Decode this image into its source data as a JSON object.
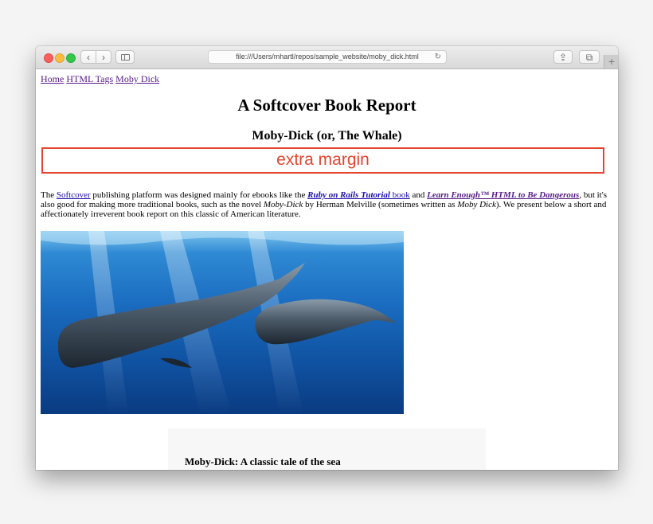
{
  "browser": {
    "url": "file:///Users/mhartl/repos/sample_website/moby_dick.html",
    "back_glyph": "‹",
    "forward_glyph": "›",
    "reload_glyph": "↻",
    "share_glyph": "⇪",
    "tabs_glyph": "⧉",
    "new_tab_glyph": "+"
  },
  "nav": {
    "links": [
      "Home",
      "HTML Tags",
      "Moby Dick"
    ]
  },
  "page": {
    "title": "A Softcover Book Report",
    "subtitle": "Moby-Dick (or, The Whale)",
    "annotation": "extra margin",
    "intro": {
      "t1": "The ",
      "link_softcover": "Softcover",
      "t2": " publishing platform was designed mainly for ebooks like the ",
      "link_rails_em": "Ruby on Rails Tutorial",
      "link_rails_rest": " book",
      "t3": " and ",
      "link_html_em": "Learn Enough™ HTML to Be Dangerous",
      "t4": ", but it's also good for making more traditional books, such as the novel ",
      "em_moby1": "Moby-Dick",
      "t5": " by Herman Melville (sometimes written as ",
      "em_moby2": "Moby Dick",
      "t6": "). We present below a short and affectionately irreverent book report on this classic of American literature."
    },
    "card_title": "Moby-Dick: A classic tale of the sea"
  },
  "colors": {
    "annotation": "#e3462e",
    "link": "#1a0dab",
    "visited_link": "#551a8b"
  }
}
